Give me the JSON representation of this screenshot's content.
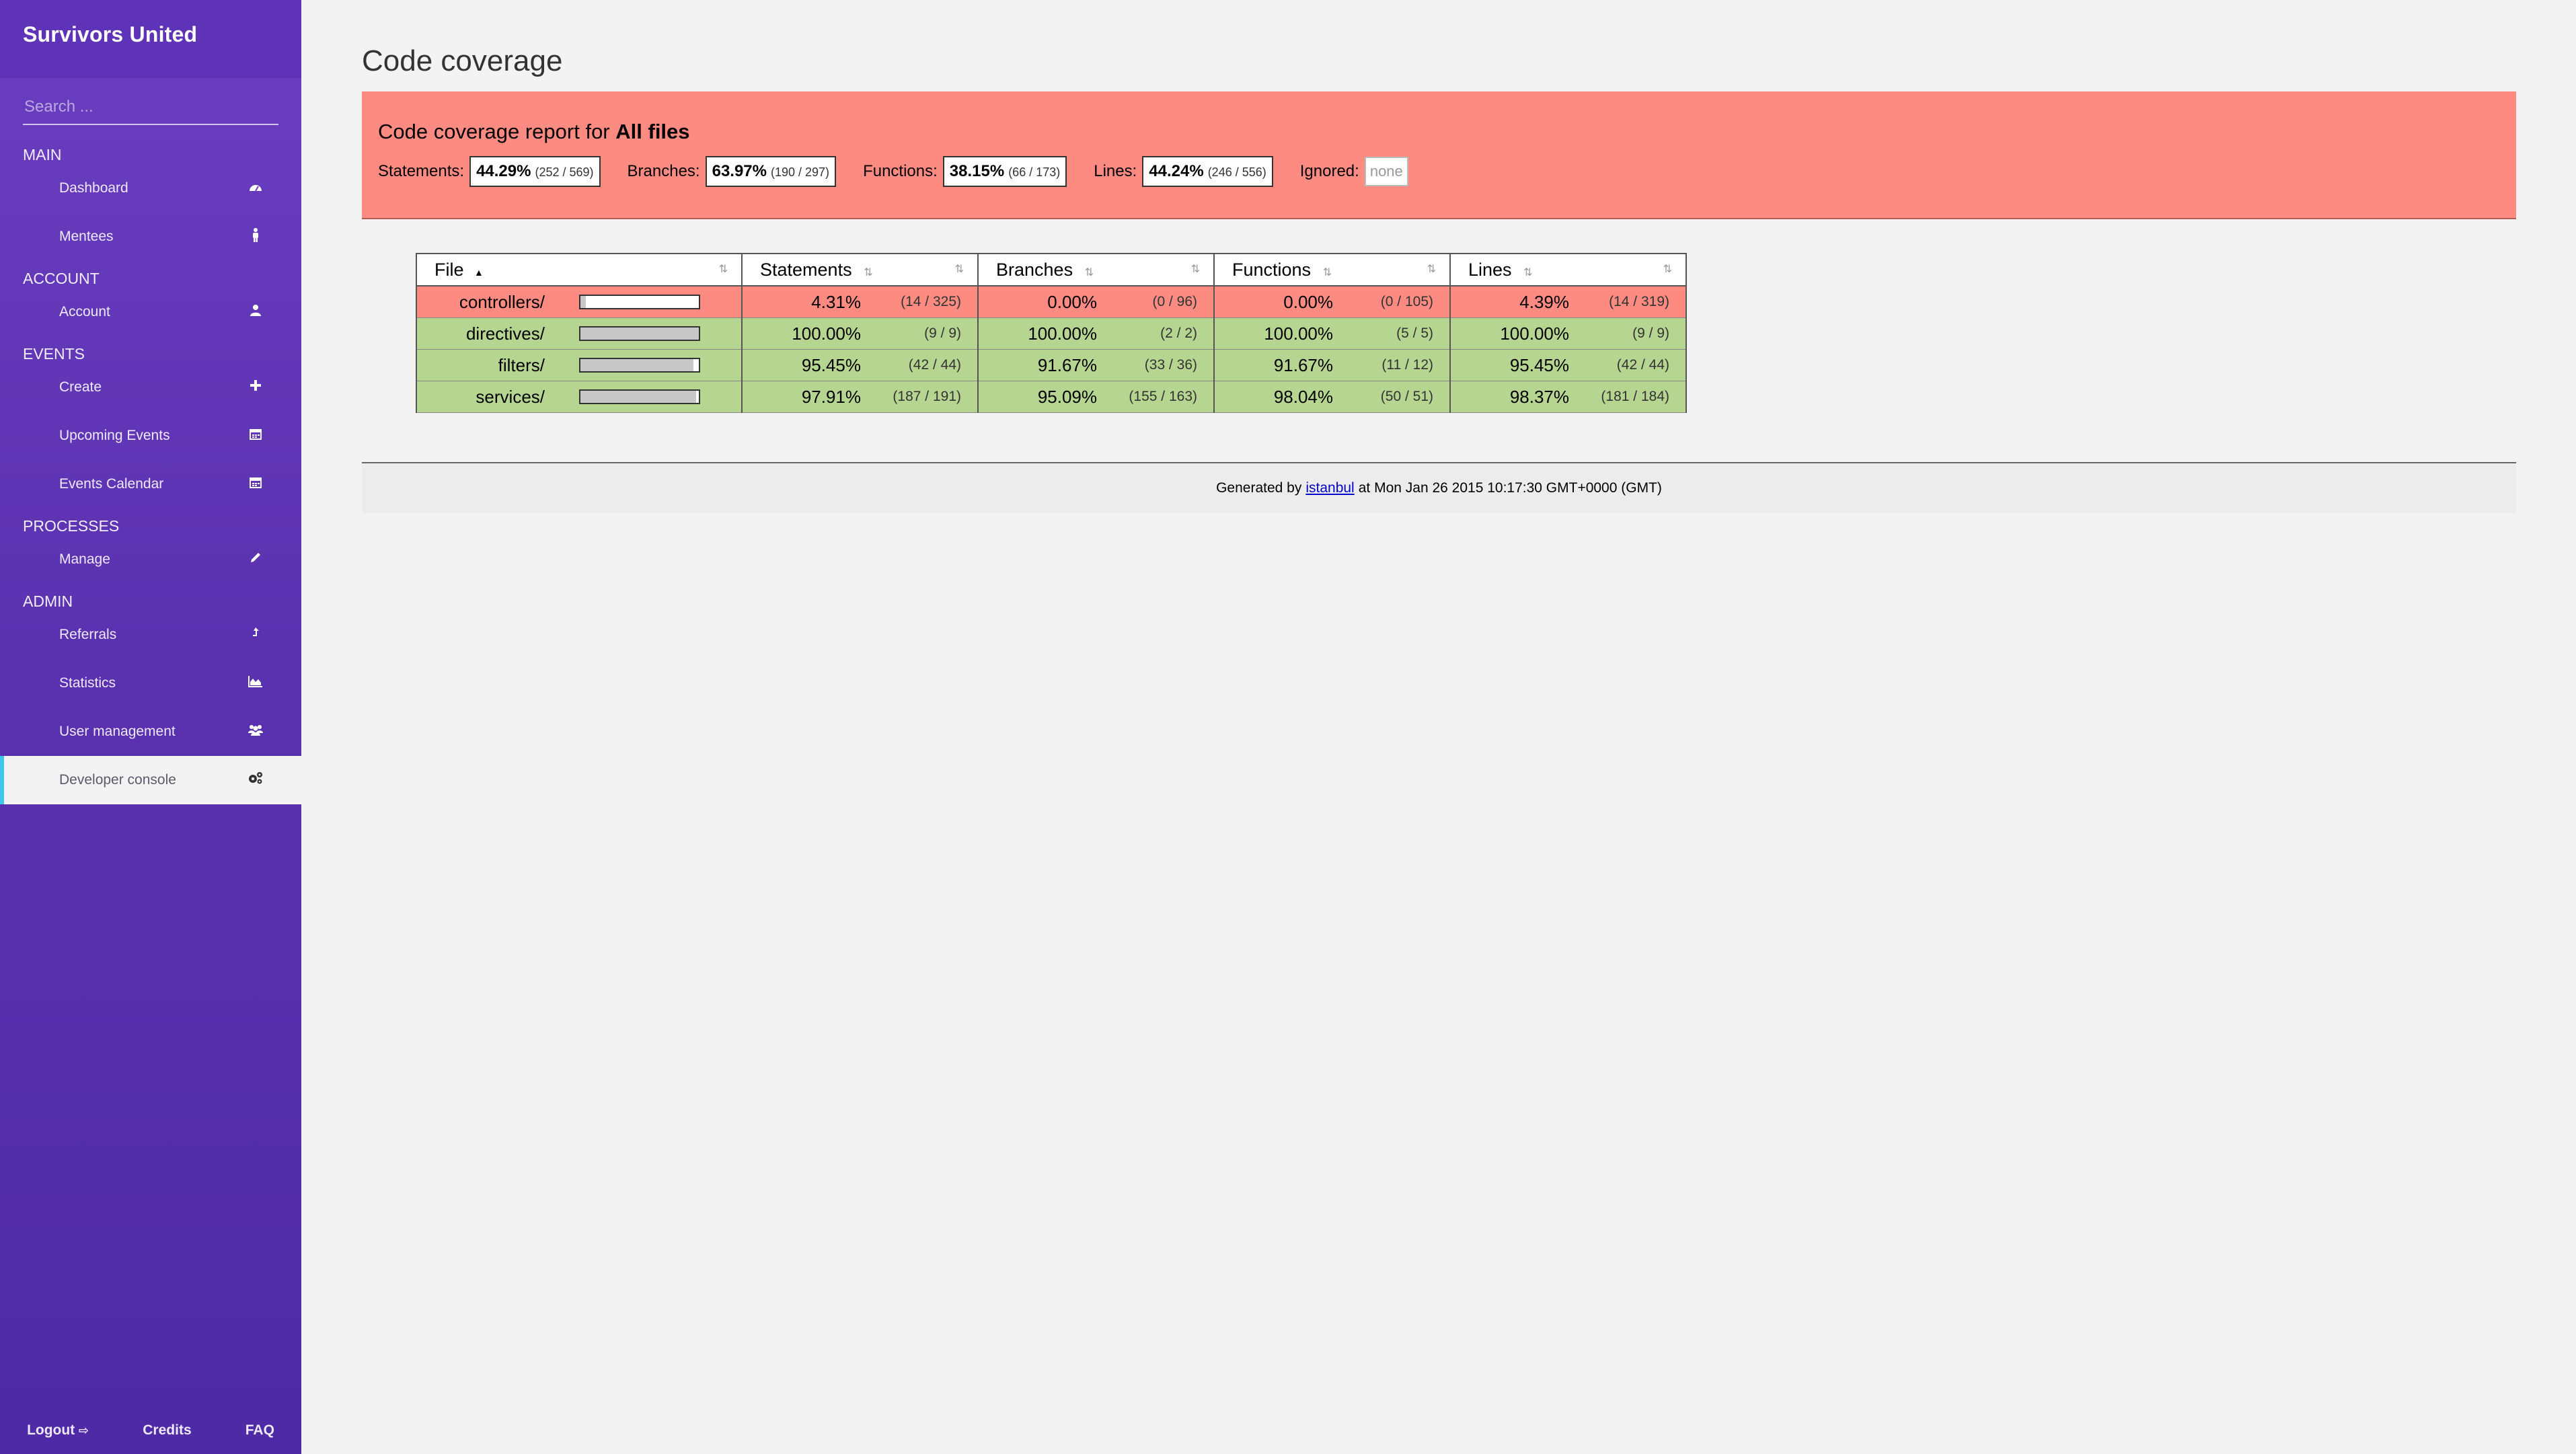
{
  "sidebar": {
    "brand": "Survivors United",
    "search_placeholder": "Search ...",
    "sections": [
      {
        "title": "MAIN",
        "items": [
          {
            "label": "Dashboard",
            "icon": "dashboard-icon"
          },
          {
            "label": "Mentees",
            "icon": "person-icon"
          }
        ]
      },
      {
        "title": "ACCOUNT",
        "items": [
          {
            "label": "Account",
            "icon": "user-icon"
          }
        ]
      },
      {
        "title": "EVENTS",
        "items": [
          {
            "label": "Create",
            "icon": "plus-icon"
          },
          {
            "label": "Upcoming Events",
            "icon": "calendar-icon"
          },
          {
            "label": "Events Calendar",
            "icon": "calendar-icon"
          }
        ]
      },
      {
        "title": "PROCESSES",
        "items": [
          {
            "label": "Manage",
            "icon": "pencil-icon"
          }
        ]
      },
      {
        "title": "ADMIN",
        "items": [
          {
            "label": "Referrals",
            "icon": "share-icon"
          },
          {
            "label": "Statistics",
            "icon": "area-chart-icon"
          },
          {
            "label": "User management",
            "icon": "users-icon"
          },
          {
            "label": "Developer console",
            "icon": "gears-icon",
            "active": true
          }
        ]
      }
    ],
    "footer": {
      "logout": "Logout",
      "credits": "Credits",
      "faq": "FAQ"
    }
  },
  "main": {
    "title": "Code coverage",
    "summary": {
      "heading_prefix": "Code coverage report for",
      "heading_target": "All files",
      "metrics": [
        {
          "label": "Statements:",
          "pct": "44.29%",
          "frac": "(252 / 569)"
        },
        {
          "label": "Branches:",
          "pct": "63.97%",
          "frac": "(190 / 297)"
        },
        {
          "label": "Functions:",
          "pct": "38.15%",
          "frac": "(66 / 173)"
        },
        {
          "label": "Lines:",
          "pct": "44.24%",
          "frac": "(246 / 556)"
        }
      ],
      "ignored_label": "Ignored:",
      "ignored_value": "none"
    },
    "table": {
      "headers": {
        "file": "File",
        "statements": "Statements",
        "branches": "Branches",
        "functions": "Functions",
        "lines": "Lines"
      },
      "rows": [
        {
          "file": "controllers/",
          "status": "low",
          "coverage": 0.043,
          "stmt_pct": "4.31%",
          "stmt_abs": "(14 / 325)",
          "br_pct": "0.00%",
          "br_abs": "(0 / 96)",
          "fn_pct": "0.00%",
          "fn_abs": "(0 / 105)",
          "ln_pct": "4.39%",
          "ln_abs": "(14 / 319)"
        },
        {
          "file": "directives/",
          "status": "high",
          "coverage": 1.0,
          "stmt_pct": "100.00%",
          "stmt_abs": "(9 / 9)",
          "br_pct": "100.00%",
          "br_abs": "(2 / 2)",
          "fn_pct": "100.00%",
          "fn_abs": "(5 / 5)",
          "ln_pct": "100.00%",
          "ln_abs": "(9 / 9)"
        },
        {
          "file": "filters/",
          "status": "high",
          "coverage": 0.9545,
          "stmt_pct": "95.45%",
          "stmt_abs": "(42 / 44)",
          "br_pct": "91.67%",
          "br_abs": "(33 / 36)",
          "fn_pct": "91.67%",
          "fn_abs": "(11 / 12)",
          "ln_pct": "95.45%",
          "ln_abs": "(42 / 44)"
        },
        {
          "file": "services/",
          "status": "high",
          "coverage": 0.9791,
          "stmt_pct": "97.91%",
          "stmt_abs": "(187 / 191)",
          "br_pct": "95.09%",
          "br_abs": "(155 / 163)",
          "fn_pct": "98.04%",
          "fn_abs": "(50 / 51)",
          "ln_pct": "98.37%",
          "ln_abs": "(181 / 184)"
        }
      ]
    },
    "footer": {
      "prefix": "Generated by",
      "link": "istanbul",
      "suffix": "at Mon Jan 26 2015 10:17:30 GMT+0000 (GMT)"
    }
  }
}
